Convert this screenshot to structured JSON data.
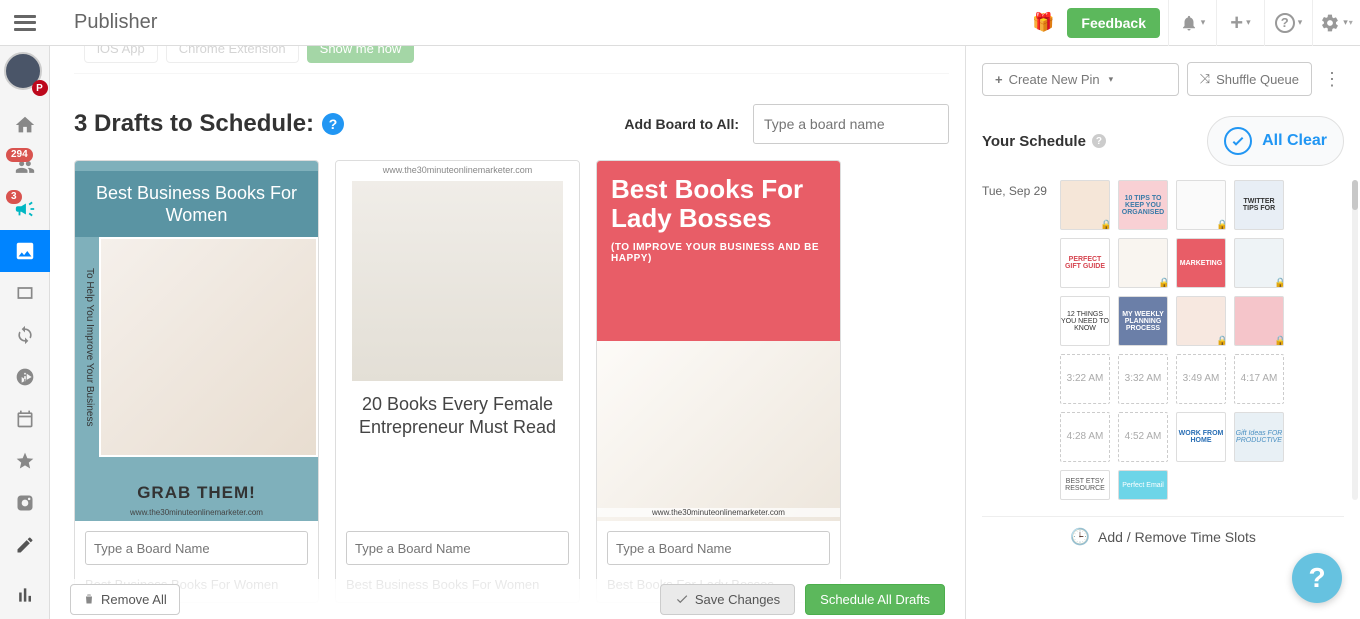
{
  "header": {
    "title": "Publisher",
    "feedback": "Feedback"
  },
  "leftnav": {
    "badge_tribes": "294",
    "badge_megaphone": "3"
  },
  "pills": {
    "ios": "iOS App",
    "chrome": "Chrome Extension",
    "green": "Show me how"
  },
  "drafts": {
    "heading": "3 Drafts to Schedule:",
    "add_board_label": "Add Board to All:",
    "add_board_placeholder": "Type a board name",
    "card_input_placeholder": "Type a Board Name"
  },
  "cards": [
    {
      "header": "Best Business Books For Women",
      "sidebar": "To Help You Improve Your Business",
      "footer": "GRAB THEM!",
      "url": "www.the30minuteonlinemarketer.com",
      "caption": "Best Business Books For Women"
    },
    {
      "url": "www.the30minuteonlinemarketer.com",
      "title": "20 Books Every Female Entrepreneur Must Read",
      "caption": "Best Business Books For Women"
    },
    {
      "title": "Best Books For Lady Bosses",
      "sub": "(TO IMPROVE YOUR BUSINESS AND BE HAPPY)",
      "url": "www.the30minuteonlinemarketer.com",
      "caption": "Best Books For Lady Bosses"
    }
  ],
  "actions": {
    "remove_all": "Remove All",
    "save_changes": "Save Changes",
    "schedule_all": "Schedule All Drafts"
  },
  "side": {
    "create_new_pin": "Create New Pin",
    "shuffle_queue": "Shuffle Queue",
    "your_schedule": "Your Schedule",
    "all_clear": "All Clear",
    "date": "Tue, Sep 29",
    "time_slots": "Add / Remove Time Slots",
    "empty_times": [
      "3:22 AM",
      "3:32 AM",
      "3:49 AM",
      "4:17 AM",
      "4:28 AM",
      "4:52 AM"
    ]
  },
  "thumbs": {
    "r1c2": "10 TIPS TO KEEP YOU ORGANISED",
    "r1c4": "TWITTER TIPS FOR",
    "r2c1": "PERFECT GIFT GUIDE",
    "r2c3": "MARKETING",
    "r3c1": "12 THINGS YOU NEED TO KNOW",
    "r3c2": "MY WEEKLY PLANNING PROCESS",
    "r5c3": "WORK FROM HOME",
    "r5c4": "Gift Ideas FOR PRODUCTIVE",
    "r6c1": "BEST ETSY RESOURCE",
    "r6c2": "Perfect Email"
  }
}
